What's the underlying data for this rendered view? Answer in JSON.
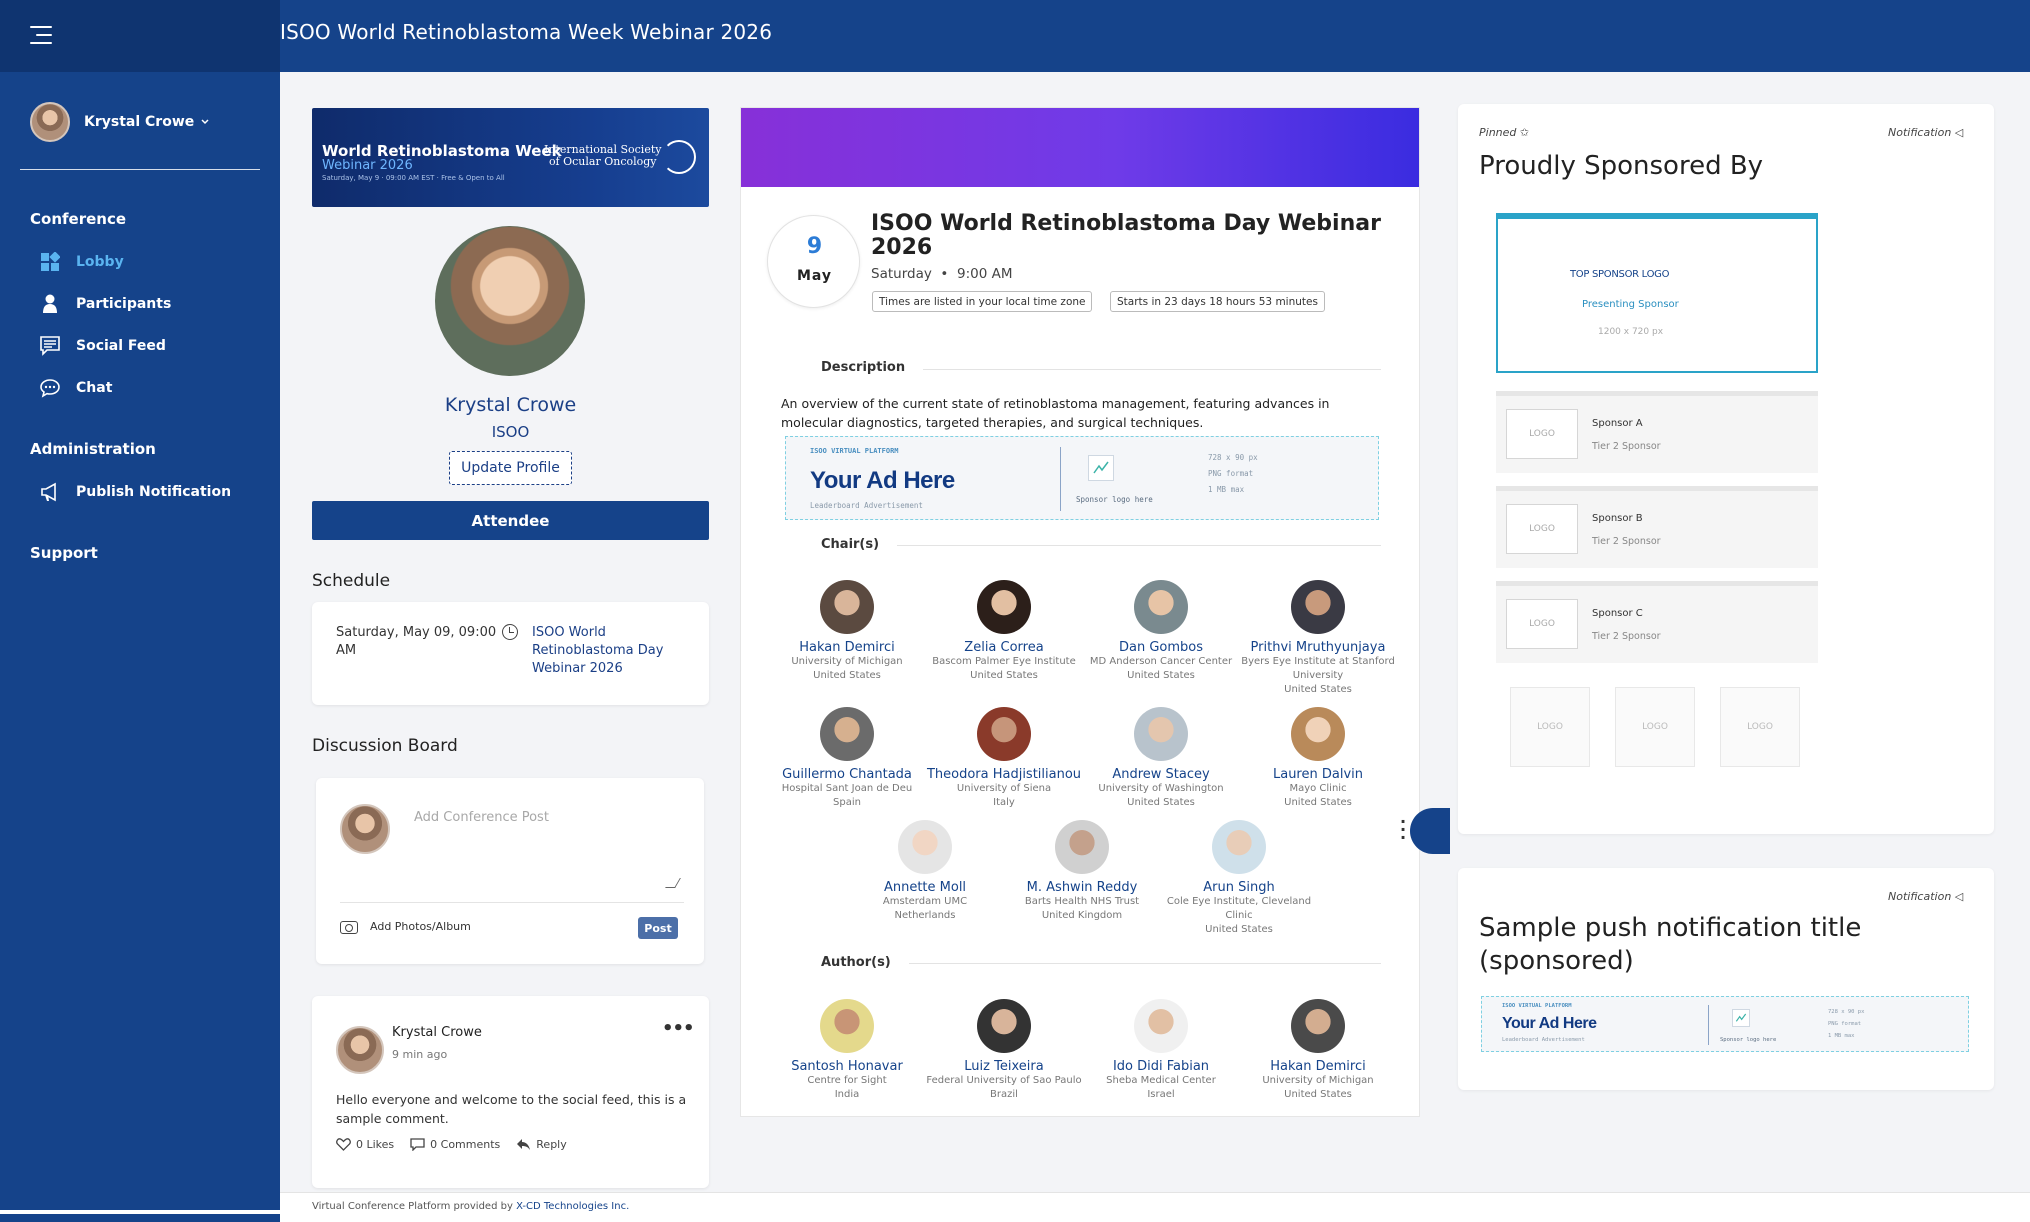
{
  "topbar": {
    "title": "ISOO World Retinoblastoma Week Webinar 2026"
  },
  "sidebar": {
    "user_name": "Krystal Crowe",
    "sections": {
      "conference": "Conference",
      "administration": "Administration",
      "support": "Support"
    },
    "items": {
      "lobby": "Lobby",
      "participants": "Participants",
      "social_feed": "Social Feed",
      "chat": "Chat",
      "publish_notification": "Publish Notification"
    },
    "active_item": "Lobby"
  },
  "colors": {
    "brand": "#15438a",
    "brand_dark": "#0f3470",
    "active": "#5ab4f0",
    "event_gradient_start": "#8730d8",
    "event_gradient_end": "#3a2ce0",
    "sponsor_accent": "#2aa3c8"
  },
  "profile": {
    "banner_title": "World Retinoblastoma Week",
    "banner_subtitle": "Webinar 2026",
    "banner_details": "Saturday, May 9  ·  09:00 AM EST  ·  Free & Open to All",
    "banner_org_line1": "International Society",
    "banner_org_line2": "of Ocular Oncology",
    "name": "Krystal Crowe",
    "org": "ISOO",
    "update_button": "Update Profile",
    "role": "Attendee"
  },
  "schedule": {
    "heading": "Schedule",
    "date": "Saturday, May 09, 09:00 AM",
    "title": "ISOO World Retinoblastoma Day Webinar 2026"
  },
  "discussion": {
    "heading": "Discussion Board",
    "placeholder": "Add Conference Post",
    "add_photos": "Add Photos/Album",
    "post_button": "Post"
  },
  "feed_post": {
    "author": "Krystal Crowe",
    "time": "9 min ago",
    "text": "Hello everyone and welcome to the social feed, this is a sample comment.",
    "likes": "0 Likes",
    "comments": "0 Comments",
    "reply": "Reply"
  },
  "footer": {
    "prefix": "Virtual Conference Platform provided by ",
    "company": "X-CD Technologies Inc."
  },
  "event": {
    "day": "9",
    "month": "May",
    "title": "ISOO World Retinoblastoma Day Webinar 2026",
    "weekday": "Saturday",
    "time": "9:00 AM",
    "tz_pill": "Times are listed in your local time zone",
    "countdown_pill": "Starts in 23 days 18 hours 53 minutes",
    "description_heading": "Description",
    "description": "An overview of the current state of retinoblastoma management, featuring advances in molecular diagnostics, targeted therapies, and surgical techniques.",
    "chairs_heading": "Chair(s)",
    "authors_heading": "Author(s)",
    "chairs": [
      {
        "name": "Hakan Demirci",
        "affiliation": "University of Michigan",
        "country": "United States"
      },
      {
        "name": "Zelia Correa",
        "affiliation": "Bascom Palmer Eye Institute",
        "country": "United States"
      },
      {
        "name": "Dan Gombos",
        "affiliation": "MD Anderson Cancer Center",
        "country": "United States"
      },
      {
        "name": "Prithvi Mruthyunjaya",
        "affiliation": "Byers Eye Institute at Stanford University",
        "country": "United States"
      },
      {
        "name": "Guillermo Chantada",
        "affiliation": "Hospital Sant Joan de Deu",
        "country": "Spain"
      },
      {
        "name": "Theodora Hadjistilianou",
        "affiliation": "University of Siena",
        "country": "Italy"
      },
      {
        "name": "Andrew Stacey",
        "affiliation": "University of Washington",
        "country": "United States"
      },
      {
        "name": "Lauren Dalvin",
        "affiliation": "Mayo Clinic",
        "country": "United States"
      },
      {
        "name": "Annette Moll",
        "affiliation": "Amsterdam UMC",
        "country": "Netherlands"
      },
      {
        "name": "M. Ashwin Reddy",
        "affiliation": "Barts Health NHS Trust",
        "country": "United Kingdom"
      },
      {
        "name": "Arun Singh",
        "affiliation": "Cole Eye Institute, Cleveland Clinic",
        "country": "United States"
      }
    ],
    "authors": [
      {
        "name": "Santosh Honavar",
        "affiliation": "Centre for Sight",
        "country": "India"
      },
      {
        "name": "Luiz Teixeira",
        "affiliation": "Federal University of Sao Paulo",
        "country": "Brazil"
      },
      {
        "name": "Ido Didi Fabian",
        "affiliation": "Sheba Medical Center",
        "country": "Israel"
      },
      {
        "name": "Hakan Demirci",
        "affiliation": "University of Michigan",
        "country": "United States"
      }
    ]
  },
  "ad": {
    "platform": "ISOO VIRTUAL PLATFORM",
    "headline": "Your Ad Here",
    "kind": "Leaderboard Advertisement",
    "logo_text": "Sponsor logo here",
    "spec_size": "728 x 90 px",
    "spec_format": "PNG format",
    "spec_max": "1 MB max"
  },
  "sponsors": {
    "pinned": "Pinned",
    "notification": "Notification",
    "title": "Proudly Sponsored By",
    "top_logo": "TOP SPONSOR LOGO",
    "top_label": "Presenting Sponsor",
    "top_size": "1200 x 720 px",
    "tier2": [
      {
        "logo": "LOGO",
        "name": "Sponsor A",
        "tier": "Tier 2 Sponsor"
      },
      {
        "logo": "LOGO",
        "name": "Sponsor B",
        "tier": "Tier 2 Sponsor"
      },
      {
        "logo": "LOGO",
        "name": "Sponsor C",
        "tier": "Tier 2 Sponsor"
      }
    ],
    "tier3": [
      "LOGO",
      "LOGO",
      "LOGO"
    ]
  },
  "push": {
    "notification": "Notification",
    "title": "Sample push notification title (sponsored)"
  }
}
